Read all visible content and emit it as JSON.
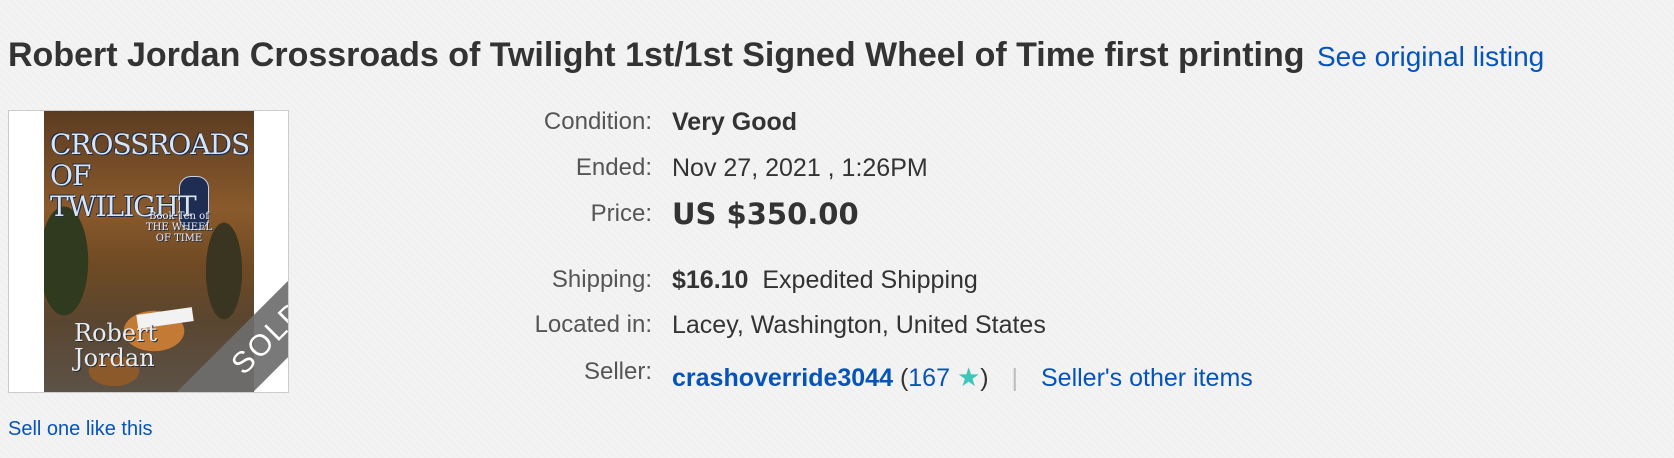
{
  "listing": {
    "title": "Robert Jordan Crossroads of Twilight 1st/1st Signed Wheel of Time first printing",
    "see_original": "See original listing",
    "sell_one": "Sell one like this",
    "image": {
      "cover_title": "CROSSROADS OF TWILIGHT",
      "cover_sub": "Book Ten of THE WHEEL OF TIME",
      "cover_author": "Robert Jordan",
      "sold_ribbon": "SOLD"
    }
  },
  "details": {
    "condition_label": "Condition:",
    "condition_value": "Very Good",
    "ended_label": "Ended:",
    "ended_value": "Nov 27, 2021 , 1:26PM",
    "price_label": "Price:",
    "price_value": "US $350.00",
    "shipping_label": "Shipping:",
    "shipping_cost": "$16.10",
    "shipping_method": "Expedited Shipping",
    "located_label": "Located in:",
    "located_value": "Lacey, Washington, United States",
    "seller_label": "Seller:",
    "seller_name": "crashoverride3044",
    "feedback_open": "(",
    "feedback_score": "167",
    "feedback_close": ")",
    "separator": "|",
    "other_items": "Seller's other items"
  },
  "colors": {
    "link": "#0654ba",
    "star": "#3cc7b8",
    "background": "#f3f3f3"
  },
  "icons": {
    "feedback_star": "star-icon"
  }
}
